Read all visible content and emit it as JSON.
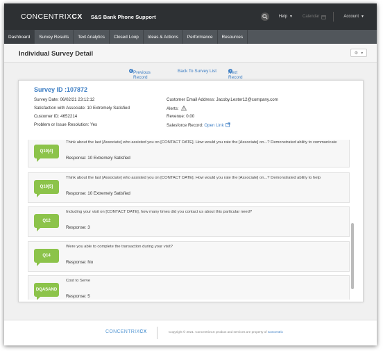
{
  "header": {
    "logo_light": "CONCENTRIX",
    "logo_bold": "CX",
    "app_title": "S&S Bank Phone Support",
    "help_label": "Help",
    "calendar_label": "Calendar",
    "account_label": "Account"
  },
  "nav": {
    "tabs": [
      "Dashboard",
      "Survey Results",
      "Text Analytics",
      "Closed Loop",
      "Ideas & Actions",
      "Performance",
      "Resources"
    ],
    "active_index": 0
  },
  "page": {
    "title": "Individual Survey Detail",
    "settings_icon": "⚙"
  },
  "pager": {
    "previous": "Previous Record",
    "back": "Back To Survey List",
    "next": "Next Record"
  },
  "survey": {
    "id_label": "Survey ID :107872",
    "left": [
      "Survey Date: 06/02/21 23:12:12",
      "Satisfaction with Associate: 10 Extremely Satisfied",
      "Customer ID: 4652214",
      "Problem or Issue Resolution: Yes"
    ],
    "email": "Customer Email Address: Jacoby.Lester12@company.com",
    "alerts": "Alerts:",
    "revenue": "Revenue: 0.00",
    "salesforce_label": "Salesforce Record:",
    "salesforce_link": "Open Link"
  },
  "questions": [
    {
      "code": "Q10[4]",
      "text": "Think about the last [Associate] who assisted you on [CONTACT DATE]. How would you rate the [Associate] on...? Demonstrated ability to communicate",
      "response": "Response: 10 Extremely Satisfied"
    },
    {
      "code": "Q10[5]",
      "text": "Think about the last [Associate] who assisted you on [CONTACT DATE]. How would you rate the [Associate] on...? Demonstrated ability to help",
      "response": "Response: 10 Extremely Satisfied"
    },
    {
      "code": "Q12",
      "text": "Including your visit on [CONTACT DATE], how many times did you contact us about this particular need?",
      "response": "Response: 3"
    },
    {
      "code": "Q14",
      "text": "Were you able to complete the transaction during your visit?",
      "response": "Response: No"
    },
    {
      "code": "DQASAND",
      "text": "Cost to Serve",
      "response": "Response: 5"
    }
  ],
  "footer": {
    "logo_light": "CONCENTRIX",
    "logo_bold": "CX",
    "copyright": "Copyright © 2021. ConcentrixCX product and services are property of",
    "company": "Concentrix"
  },
  "colors": {
    "accent": "#3a7cc3",
    "bubble": "#8cc34a",
    "topbar": "#2d3033",
    "navbar": "#51565b"
  }
}
